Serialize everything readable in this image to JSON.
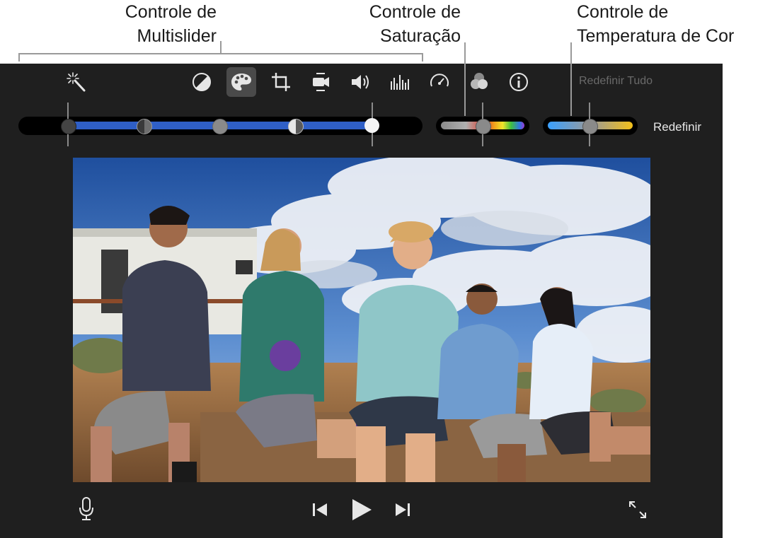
{
  "callouts": {
    "multislider_line1": "Controle de",
    "multislider_line2": "Multislider",
    "saturation_line1": "Controle de",
    "saturation_line2": "Saturação",
    "temperature_line1": "Controle de",
    "temperature_line2": "Temperatura de Cor"
  },
  "toolbar": {
    "active_tool": "color-balance",
    "icons": [
      "magic-wand-icon",
      "color-balance-icon",
      "palette-icon",
      "crop-icon",
      "stabilization-icon",
      "volume-icon",
      "equalizer-icon",
      "speed-icon",
      "filter-icon",
      "info-icon"
    ],
    "reset_all_label": "Redefinir Tudo"
  },
  "adjustments": {
    "reset_label": "Redefinir",
    "multislider": {
      "handles": [
        "black-point",
        "shadows",
        "midtones",
        "highlights",
        "white-point"
      ]
    },
    "saturation": {
      "level": 0.5
    },
    "temperature": {
      "level": 0.5
    }
  },
  "viewer": {
    "content": "photo-of-five-people-shouting-in-desert"
  },
  "playback": {
    "icons": [
      "microphone-icon",
      "skip-back-icon",
      "play-icon",
      "skip-forward-icon",
      "fullscreen-icon"
    ]
  },
  "colors": {
    "panel": "#1f1f1f",
    "slider_blue": "#2f5fc7",
    "callout_text": "#1a1a1a"
  }
}
